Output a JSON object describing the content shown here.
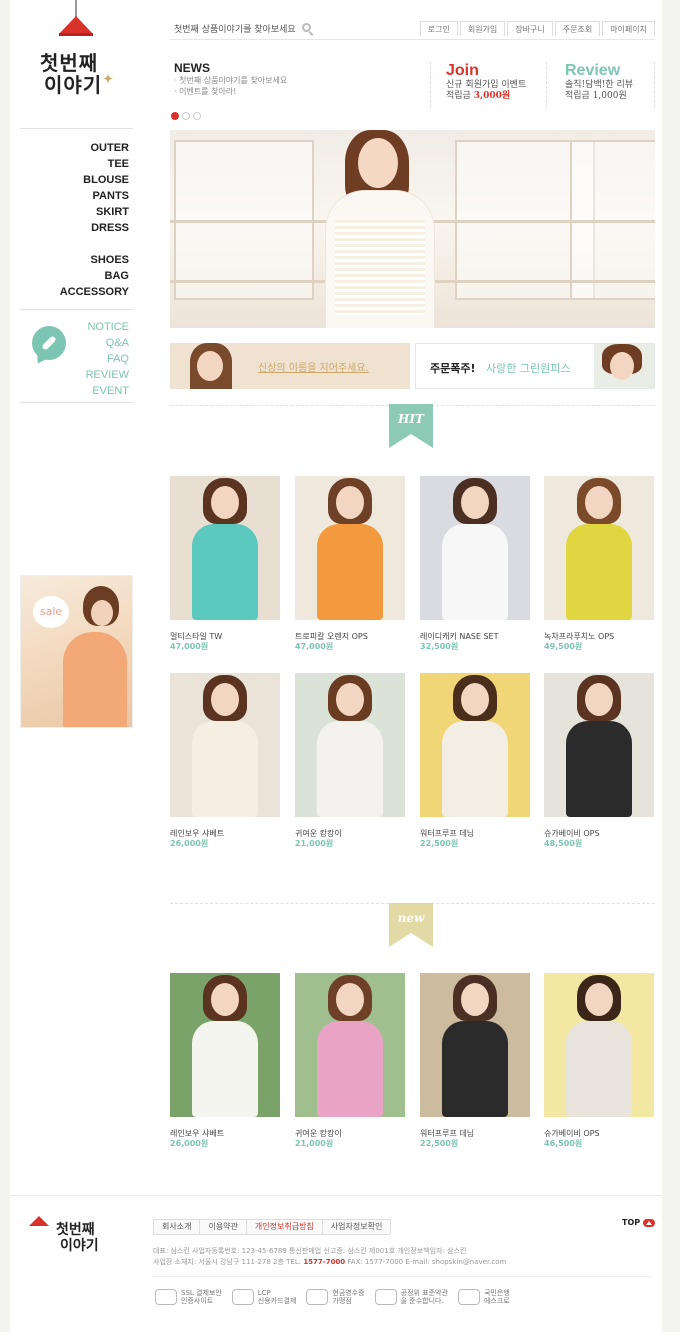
{
  "brand": {
    "logo_line1": "첫번째",
    "logo_line2": "이야기",
    "sparkle": "✦"
  },
  "header": {
    "search_placeholder": "첫번째 상품이야기를 찾아보세요",
    "top_links": [
      "로그인",
      "회원가입",
      "장바구니",
      "주문조회",
      "마이페이지"
    ]
  },
  "news": {
    "title": "NEWS",
    "items": [
      "· 첫번째 상품이야기를 찾아보세요",
      "· 이벤트를 찾아라!"
    ]
  },
  "promos": {
    "join": {
      "title": "Join",
      "line1": "신규 회원가입 이벤트",
      "line2_prefix": "적립금 ",
      "line2_amount": "3,000원"
    },
    "review": {
      "title": "Review",
      "line1": "솔직!담백!한 리뷰",
      "line2": "적립금 1,000원"
    }
  },
  "slider_dots": 3,
  "sidebar": {
    "categories1": [
      "OUTER",
      "TEE",
      "BLOUSE",
      "PANTS",
      "SKIRT",
      "DRESS"
    ],
    "categories2": [
      "SHOES",
      "BAG",
      "ACCESSORY"
    ],
    "board": [
      "NOTICE",
      "Q&A",
      "FAQ",
      "REVIEW",
      "EVENT"
    ],
    "sale_label": "sale"
  },
  "sub_banners": {
    "left_text": "신상의 이름을 지어주세요.",
    "right_text_bold": "주문폭주!",
    "right_text_accent": "사랑한 그린원피스"
  },
  "sections": {
    "hit_label": "HIT",
    "new_label": "new"
  },
  "hit_products": [
    {
      "name": "멀티스타일 TW",
      "price": "47,000원"
    },
    {
      "name": "트로피칼 오렌지 OPS",
      "price": "47,000원"
    },
    {
      "name": "레이디캐키 NASE SET",
      "price": "32,500원"
    },
    {
      "name": "녹차프라푸치노 OPS",
      "price": "49,500원"
    },
    {
      "name": "레인보우 샤베트",
      "price": "26,000원"
    },
    {
      "name": "귀여운 캉캉이",
      "price": "21,000원"
    },
    {
      "name": "워터프루프 데님",
      "price": "22,500원"
    },
    {
      "name": "슈가베이비 OPS",
      "price": "48,500원"
    }
  ],
  "new_products": [
    {
      "name": "레인보우 샤베트",
      "price": "26,000원"
    },
    {
      "name": "귀여운 캉캉이",
      "price": "21,000원"
    },
    {
      "name": "워터프루프 데님",
      "price": "22,500원"
    },
    {
      "name": "슈가베이비 OPS",
      "price": "46,500원"
    }
  ],
  "footer": {
    "links": [
      "회사소개",
      "이용약관",
      "개인정보취급방침",
      "사업자정보확인"
    ],
    "top_label": "TOP",
    "info_line1": "대표: 삼스킨  사업자등록번호: 123-45-6789  통신판매업 신고증: 삼스킨 제001호  개인정보책임자: 삼스킨",
    "info_line2_prefix": "사업장 소재지: 서울시 강남구 111-278 2층  TEL: ",
    "tel": "1577-7000",
    "info_line2_suffix": "  FAX: 1577-7000  E-mail: shopskin@naver.com",
    "certs": [
      {
        "icon": "ssl-lock-icon",
        "text": "SSL 결제보안\n인증사이트"
      },
      {
        "icon": "kcp-icon",
        "text": "LCP\n신용카드결제"
      },
      {
        "icon": "cash-receipt-icon",
        "text": "현금영수증\n가맹점"
      },
      {
        "icon": "eye-icon",
        "text": "공정위 표준약관\n을 준수합니다."
      },
      {
        "icon": "escrow-icon",
        "text": "국민은행\n에스크로"
      }
    ]
  }
}
